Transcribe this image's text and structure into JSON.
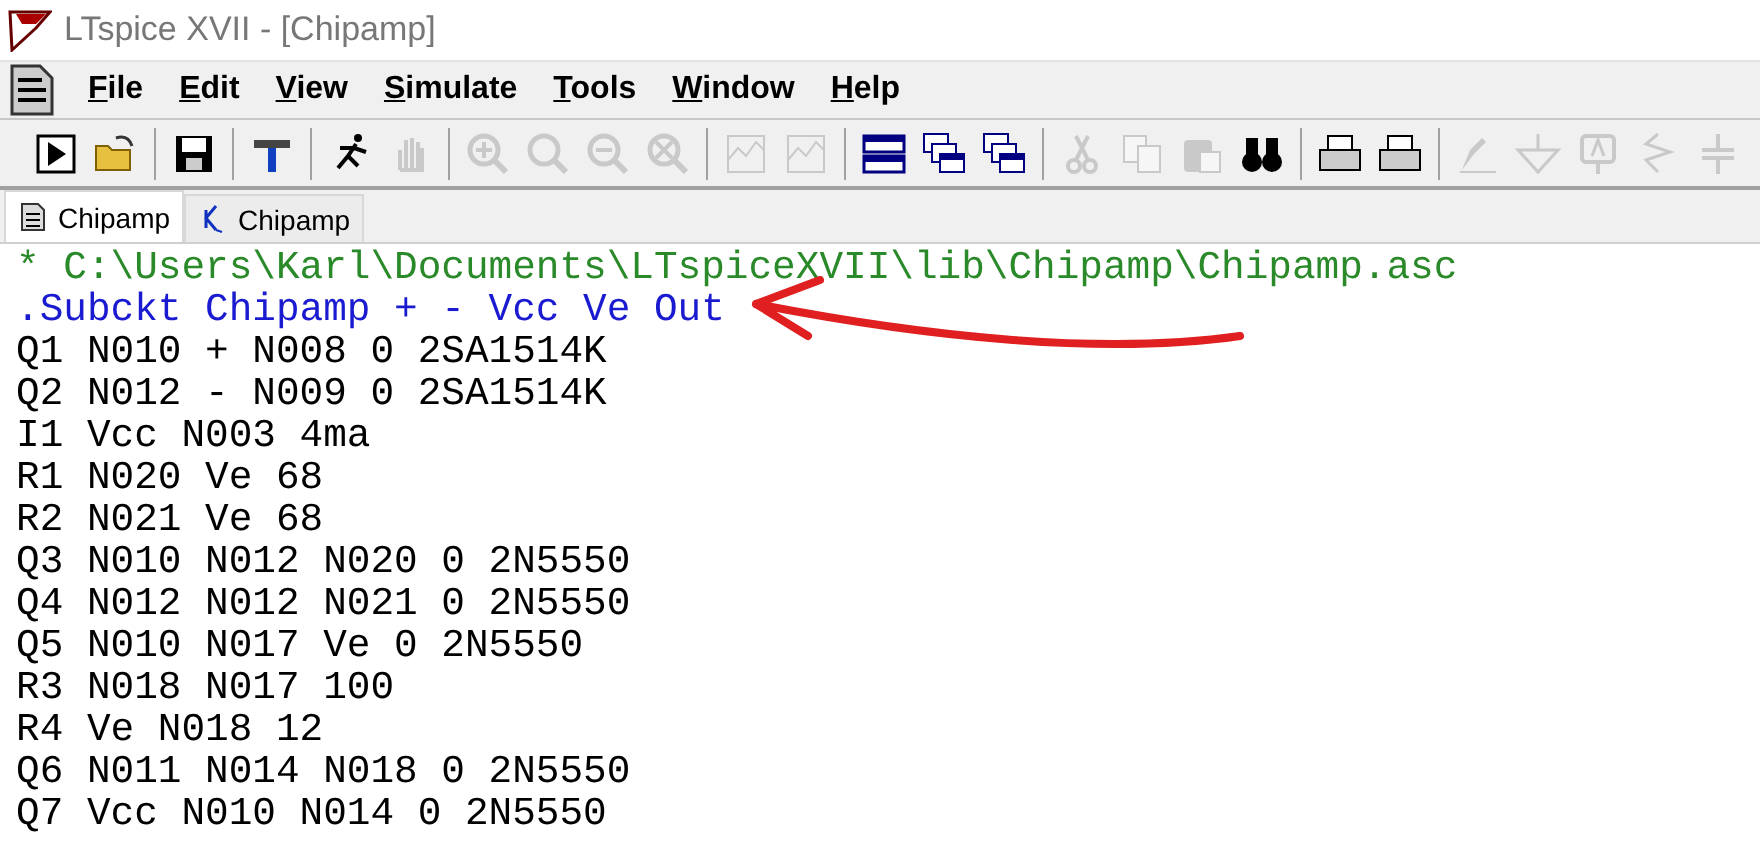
{
  "window": {
    "title": "LTspice XVII - [Chipamp]"
  },
  "menu": [
    {
      "label": "File"
    },
    {
      "label": "Edit"
    },
    {
      "label": "View"
    },
    {
      "label": "Simulate"
    },
    {
      "label": "Tools"
    },
    {
      "label": "Window"
    },
    {
      "label": "Help"
    }
  ],
  "toolbar": [
    {
      "kind": "run",
      "disabled": false
    },
    {
      "kind": "open",
      "disabled": false
    },
    {
      "kind": "sep"
    },
    {
      "kind": "save",
      "disabled": false
    },
    {
      "kind": "sep"
    },
    {
      "kind": "hammer",
      "disabled": false
    },
    {
      "kind": "sep"
    },
    {
      "kind": "runner",
      "disabled": false
    },
    {
      "kind": "hand",
      "disabled": true
    },
    {
      "kind": "sep"
    },
    {
      "kind": "zoomin",
      "disabled": true
    },
    {
      "kind": "zoom",
      "disabled": true
    },
    {
      "kind": "zoomout",
      "disabled": true
    },
    {
      "kind": "zoomx",
      "disabled": true
    },
    {
      "kind": "sep"
    },
    {
      "kind": "graph",
      "disabled": true
    },
    {
      "kind": "graph",
      "disabled": true
    },
    {
      "kind": "sep"
    },
    {
      "kind": "tile",
      "disabled": false
    },
    {
      "kind": "cascade",
      "disabled": false
    },
    {
      "kind": "cascade",
      "disabled": false
    },
    {
      "kind": "sep"
    },
    {
      "kind": "cut",
      "disabled": true
    },
    {
      "kind": "copy",
      "disabled": true
    },
    {
      "kind": "paste",
      "disabled": true
    },
    {
      "kind": "find",
      "disabled": false
    },
    {
      "kind": "sep"
    },
    {
      "kind": "print",
      "disabled": false
    },
    {
      "kind": "print",
      "disabled": false
    },
    {
      "kind": "sep"
    },
    {
      "kind": "pencil",
      "disabled": true
    },
    {
      "kind": "ground",
      "disabled": true
    },
    {
      "kind": "label",
      "disabled": true
    },
    {
      "kind": "resistor",
      "disabled": true
    },
    {
      "kind": "capacitor",
      "disabled": true
    }
  ],
  "tabs": [
    {
      "label": "Chipamp",
      "kind": "netlist",
      "selected": true
    },
    {
      "label": "Chipamp",
      "kind": "schematic",
      "selected": false
    }
  ],
  "lines": [
    {
      "kind": "comment",
      "text": "* C:\\Users\\Karl\\Documents\\LTspiceXVII\\lib\\Chipamp\\Chipamp.asc"
    },
    {
      "kind": "directive",
      "text": ".Subckt Chipamp + - Vcc Ve Out"
    },
    {
      "kind": "plain",
      "text": "Q1 N010 + N008 0 2SA1514K"
    },
    {
      "kind": "plain",
      "text": "Q2 N012 - N009 0 2SA1514K"
    },
    {
      "kind": "plain",
      "text": "I1 Vcc N003 4ma"
    },
    {
      "kind": "plain",
      "text": "R1 N020 Ve 68"
    },
    {
      "kind": "plain",
      "text": "R2 N021 Ve 68"
    },
    {
      "kind": "plain",
      "text": "Q3 N010 N012 N020 0 2N5550"
    },
    {
      "kind": "plain",
      "text": "Q4 N012 N012 N021 0 2N5550"
    },
    {
      "kind": "plain",
      "text": "Q5 N010 N017 Ve 0 2N5550"
    },
    {
      "kind": "plain",
      "text": "R3 N018 N017 100"
    },
    {
      "kind": "plain",
      "text": "R4 Ve N018 12"
    },
    {
      "kind": "plain",
      "text": "Q6 N011 N014 N018 0 2N5550"
    },
    {
      "kind": "plain",
      "text": "Q7 Vcc N010 N014 0 2N5550"
    }
  ]
}
